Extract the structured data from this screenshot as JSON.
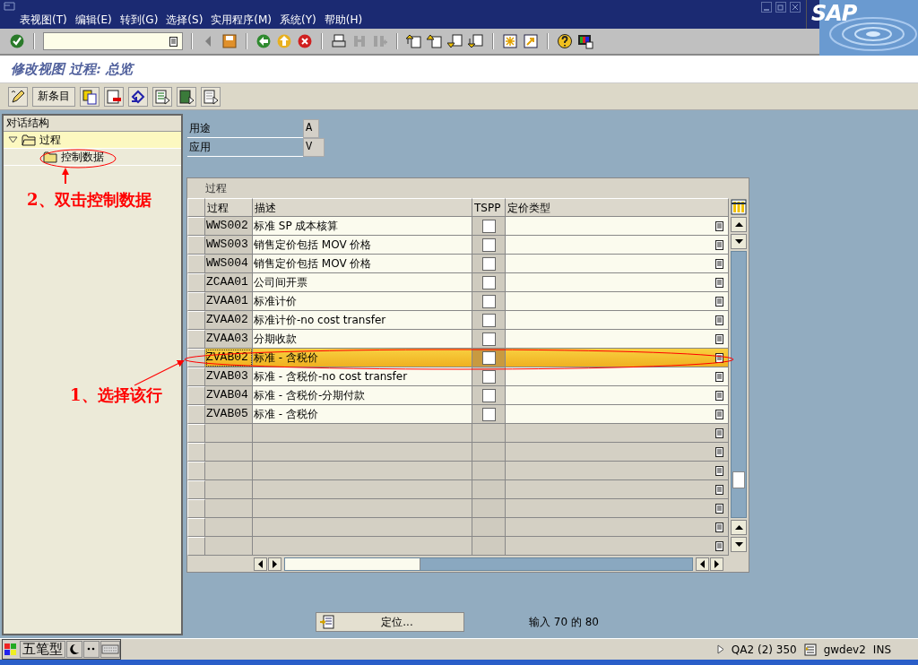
{
  "menu": [
    {
      "label": "表视图(T)"
    },
    {
      "label": "编辑(E)"
    },
    {
      "label": "转到(G)"
    },
    {
      "label": "选择(S)"
    },
    {
      "label": "实用程序(M)"
    },
    {
      "label": "系统(Y)"
    },
    {
      "label": "帮助(H)"
    }
  ],
  "logo": "SAP",
  "screen_title": "修改视图 过程: 总览",
  "new_entries_button": "新条目",
  "dialog_structure": {
    "title": "对话结构",
    "tree": [
      {
        "label": "过程",
        "expanded": true,
        "selected": true,
        "children": [
          {
            "label": "控制数据",
            "selected": false
          }
        ]
      }
    ]
  },
  "fields": [
    {
      "label": "用途",
      "value": "A"
    },
    {
      "label": "应用",
      "value": "V"
    }
  ],
  "table": {
    "title": "过程",
    "columns": [
      "过程",
      "描述",
      "TSPP",
      "定价类型"
    ],
    "rows": [
      {
        "process": "WWS002",
        "description": "标准 SP 成本核算",
        "tspp": false,
        "selected": false
      },
      {
        "process": "WWS003",
        "description": "销售定价包括 MOV 价格",
        "tspp": false,
        "selected": false
      },
      {
        "process": "WWS004",
        "description": "销售定价包括 MOV 价格",
        "tspp": false,
        "selected": false
      },
      {
        "process": "ZCAA01",
        "description": "公司间开票",
        "tspp": false,
        "selected": false
      },
      {
        "process": "ZVAA01",
        "description": "标准计价",
        "tspp": false,
        "selected": false
      },
      {
        "process": "ZVAA02",
        "description": "标准计价-no cost transfer",
        "tspp": false,
        "selected": false
      },
      {
        "process": "ZVAA03",
        "description": "分期收款",
        "tspp": false,
        "selected": false
      },
      {
        "process": "ZVAB02",
        "description": "标准 - 含税价",
        "tspp": false,
        "selected": true
      },
      {
        "process": "ZVAB03",
        "description": "标准 - 含税价-no cost transfer",
        "tspp": false,
        "selected": false
      },
      {
        "process": "ZVAB04",
        "description": "标准 - 含税价-分期付款",
        "tspp": false,
        "selected": false
      },
      {
        "process": "ZVAB05",
        "description": "标准 - 含税价",
        "tspp": false,
        "selected": false
      }
    ]
  },
  "position_button": "定位...",
  "entry_count": "输入 70 的 80",
  "status_bar": {
    "ime": "五笔型",
    "system": "QA2 (2) 350",
    "server": "gwdev2",
    "mode": "INS"
  },
  "annotations": [
    {
      "text": "2、双击控制数据"
    },
    {
      "text": "1、选择该行"
    }
  ]
}
